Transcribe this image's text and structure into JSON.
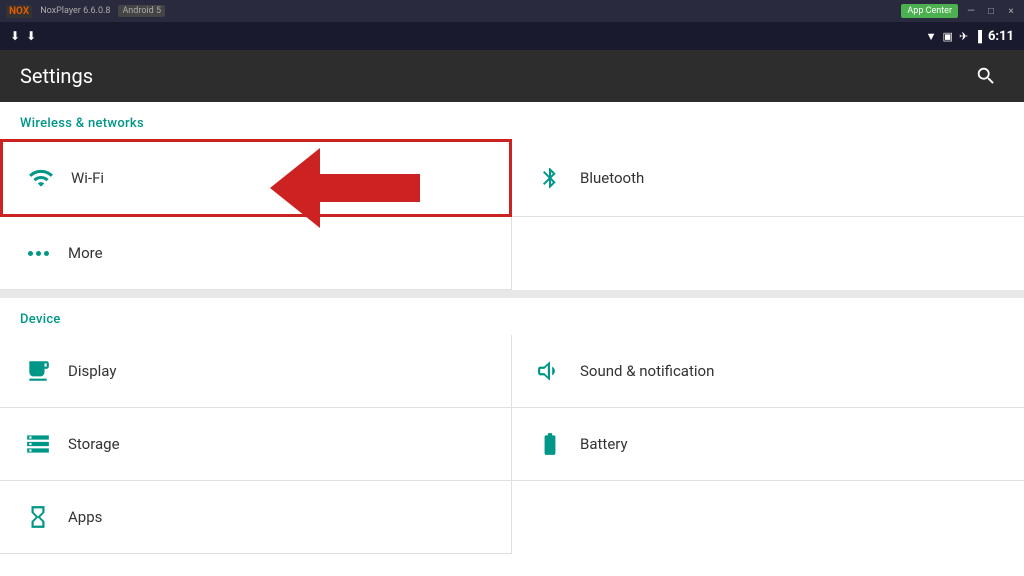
{
  "titlebar": {
    "logo": "NOX",
    "version": "NoxPlayer 6.6.0.8",
    "android": "Android 5",
    "app_center": "App Center",
    "controls": [
      "■",
      "—",
      "×"
    ]
  },
  "statusbar": {
    "time": "6:11"
  },
  "appbar": {
    "title": "Settings",
    "search_label": "Search"
  },
  "sections": {
    "wireless": {
      "header": "Wireless & networks",
      "items": [
        {
          "id": "wifi",
          "label": "Wi-Fi",
          "icon": "wifi"
        },
        {
          "id": "bluetooth",
          "label": "Bluetooth",
          "icon": "bluetooth"
        },
        {
          "id": "more",
          "label": "More",
          "icon": "more"
        }
      ]
    },
    "device": {
      "header": "Device",
      "items": [
        {
          "id": "display",
          "label": "Display",
          "icon": "display"
        },
        {
          "id": "sound",
          "label": "Sound & notification",
          "icon": "sound"
        },
        {
          "id": "storage",
          "label": "Storage",
          "icon": "storage"
        },
        {
          "id": "battery",
          "label": "Battery",
          "icon": "battery"
        },
        {
          "id": "apps",
          "label": "Apps",
          "icon": "apps"
        }
      ]
    }
  }
}
